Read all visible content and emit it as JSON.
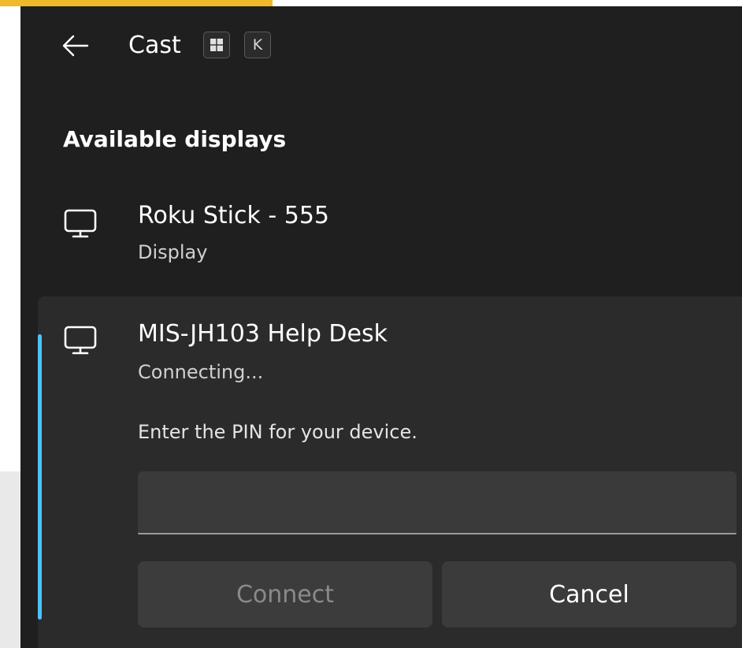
{
  "header": {
    "title": "Cast",
    "shortcut_keys": [
      "⊞",
      "K"
    ],
    "back_icon": "arrow-left-icon"
  },
  "section_title": "Available displays",
  "devices": [
    {
      "name": "Roku Stick - 555",
      "status": "Display",
      "icon": "monitor-icon"
    },
    {
      "name": "MIS-JH103 Help Desk",
      "status": "Connecting...",
      "icon": "monitor-icon",
      "selected": true,
      "pin_prompt": "Enter the PIN for your device.",
      "pin_value": "",
      "buttons": {
        "connect_label": "Connect",
        "cancel_label": "Cancel"
      }
    }
  ],
  "colors": {
    "panel_bg": "#1f1f1f",
    "card_bg": "#2b2b2b",
    "accent": "#4cc2ff",
    "top_accent": "#f0b92b"
  }
}
